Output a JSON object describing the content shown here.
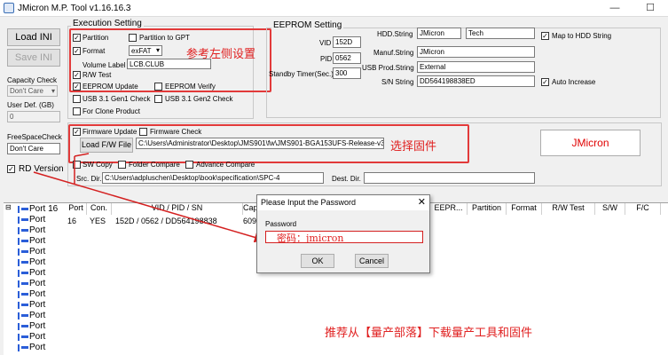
{
  "window": {
    "title": "JMicron M.P. Tool v1.16.16.3",
    "minimize": "—",
    "maximize": "☐"
  },
  "left": {
    "load_ini": "Load INI",
    "save_ini": "Save INI",
    "capacity_check_label": "Capacity Check",
    "capacity_check_value": "Don't Care",
    "user_def_label": "User Def. (GB)",
    "user_def_value": "0",
    "freespace_label": "FreeSpaceCheck",
    "freespace_value": "Don't Care",
    "rd_version": "RD Version"
  },
  "execution": {
    "title": "Execution Setting",
    "partition": "Partition",
    "partition_gpt": "Partition to GPT",
    "format": "Format",
    "format_value": "exFAT",
    "volume_label": "Volume Label",
    "volume_label_value": "LCB.CLUB",
    "rw_test": "R/W Test",
    "eeprom_update": "EEPROM Update",
    "eeprom_verify": "EEPROM Verify",
    "usb31_gen1": "USB 3.1 Gen1 Check",
    "usb31_gen2": "USB 3.1 Gen2 Check",
    "clone_product": "For Clone Product"
  },
  "eeprom": {
    "title": "EEPROM Setting",
    "vid_label": "VID",
    "vid_value": "152D",
    "pid_label": "PID",
    "pid_value": "0562",
    "standby_label": "Standby Timer(Sec.)",
    "standby_value": "300",
    "hdd_label": "HDD.String",
    "hdd_value1": "JMicron",
    "hdd_value2": "Tech",
    "manuf_label": "Manuf.String",
    "manuf_value": "JMicron",
    "usbprod_label": "USB Prod.String",
    "usbprod_value": "External",
    "sn_label": "S/N String",
    "sn_value": "DD564198838ED",
    "map_hdd": "Map to HDD String",
    "auto_increase": "Auto Increase"
  },
  "firmware": {
    "fw_update": "Firmware Update",
    "fw_check": "Firmware Check",
    "load_fw": "Load F/W File",
    "fw_path": "C:\\Users\\Administrator\\Desktop\\JMS901\\fw\\JMS901-BGA153UFS-Release-v3(",
    "sw_copy": "SW Copy",
    "folder_compare": "Folder Compare",
    "advance_compare": "Advance Compare",
    "src_label": "Src. Dir.",
    "src_value": "C:\\Users\\adpluschen\\Desktop\\book\\specification\\SPC-4",
    "dest_label": "Dest. Dir.",
    "dest_value": ""
  },
  "brand_button": "JMicron",
  "table": {
    "headers": [
      "Port",
      "Con.",
      "VID / PID / SN",
      "Cap",
      "EEPR...",
      "Partition",
      "Format",
      "R/W Test",
      "S/W",
      "F/C"
    ],
    "row1": {
      "port": "16",
      "con": "YES",
      "vidpidsn": "152D / 0562 / DD564198838",
      "cap": "6091"
    },
    "tree": [
      "Port 16",
      "Port",
      "Port",
      "Port",
      "Port",
      "Port",
      "Port",
      "Port",
      "Port",
      "Port",
      "Port",
      "Port",
      "Port",
      "Port"
    ]
  },
  "dialog": {
    "title": "Please Input the Password",
    "close": "✕",
    "password_label": "Password",
    "password_value": "密码：jmicron",
    "ok": "OK",
    "cancel": "Cancel"
  },
  "annotations": {
    "ref_settings": "参考左侧设置",
    "select_firmware": "选择固件",
    "recommend": "推荐从【量产部落】下载量产工具和固件"
  },
  "colors": {
    "annotation_red": "#e02020",
    "brand_red": "#e00000"
  }
}
